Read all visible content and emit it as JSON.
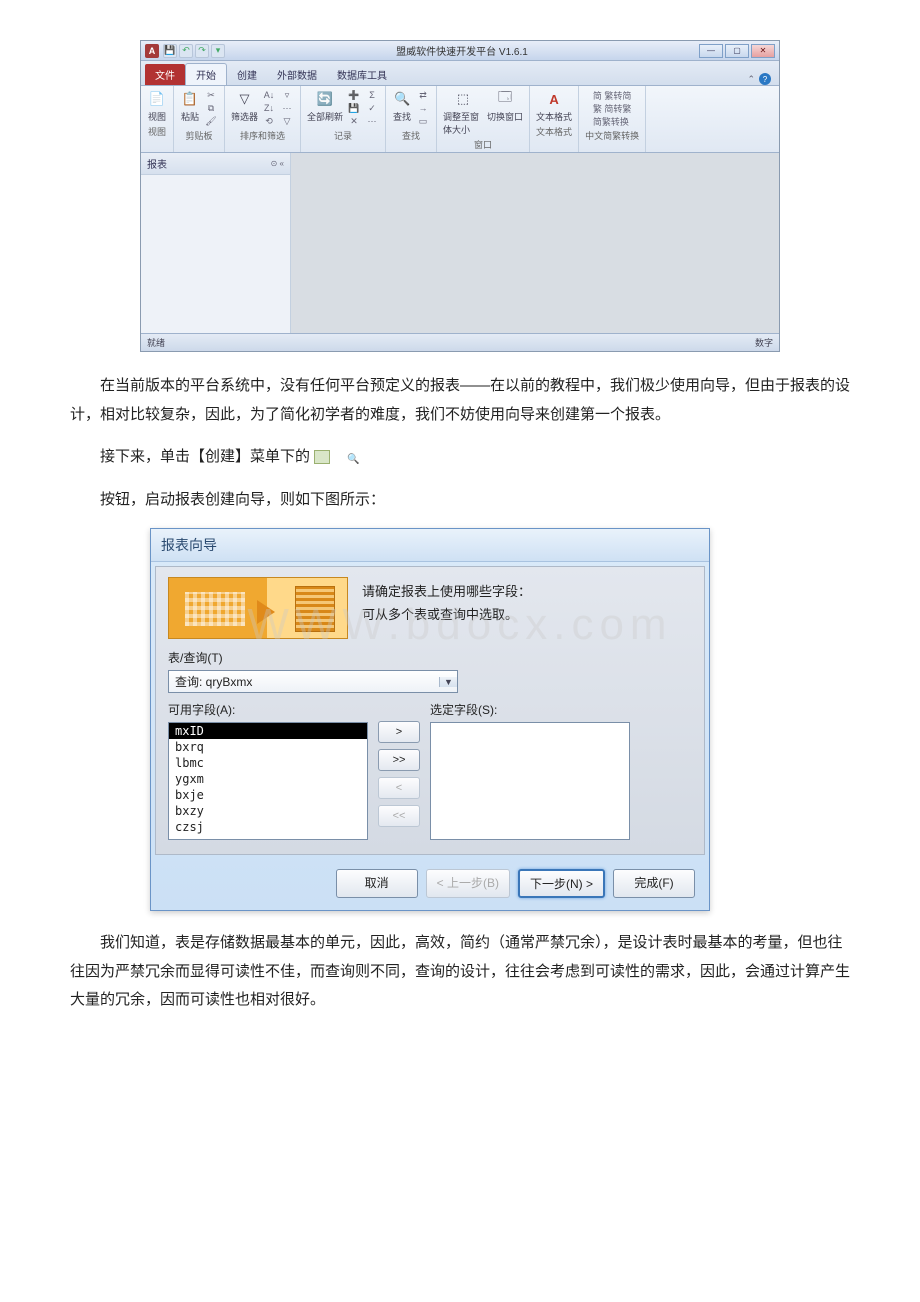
{
  "access": {
    "title": "盟威软件快速开发平台 V1.6.1",
    "file_tab": "文件",
    "tabs": [
      "开始",
      "创建",
      "外部数据",
      "数据库工具"
    ],
    "win": {
      "min": "—",
      "max": "▢",
      "close": "✕",
      "collapse": "⌃",
      "help": "?"
    },
    "groups": {
      "view": {
        "label": "视图",
        "btn": "视图"
      },
      "clipboard": {
        "label": "剪贴板",
        "btn": "粘贴"
      },
      "sort": {
        "label": "排序和筛选",
        "btn": "筛选器"
      },
      "records": {
        "label": "记录",
        "btn": "全部刷新"
      },
      "find": {
        "label": "查找",
        "btn": "查找"
      },
      "window": {
        "label": "窗口",
        "resize": "调整至窗体大小",
        "switch": "切换窗口"
      },
      "textfmt": {
        "label": "文本格式",
        "btn": "文本格式"
      },
      "zhconv": {
        "label": "中文简繁转换",
        "a": "简 繁转简",
        "b": "繁 简转繁",
        "c": "简繁转换"
      }
    },
    "nav": {
      "header": "报表",
      "toggle": "⊙ «"
    },
    "status": {
      "left": "就绪",
      "right": "数字"
    }
  },
  "para1": "在当前版本的平台系统中，没有任何平台预定义的报表——在以前的教程中，我们极少使用向导，但由于报表的设计，相对比较复杂，因此，为了简化初学者的难度，我们不妨使用向导来创建第一个报表。",
  "para2a": "接下来，单击【创建】菜单下的 ",
  "para3": "按钮，启动报表创建向导，则如下图所示：",
  "wizard": {
    "title": "报表向导",
    "head1": "请确定报表上使用哪些字段：",
    "head2": "可从多个表或查询中选取。",
    "tq_label": "表/查询(T)",
    "combo_value": "查询: qryBxmx",
    "avail_label": "可用字段(A):",
    "sel_label": "选定字段(S):",
    "fields": [
      "mxID",
      "bxrq",
      "lbmc",
      "ygxm",
      "bxje",
      "bxzy",
      "czsj"
    ],
    "btns": {
      "add": ">",
      "add_all": ">>",
      "rem": "<",
      "rem_all": "<<"
    },
    "footer": {
      "cancel": "取消",
      "back": "< 上一步(B)",
      "next": "下一步(N) >",
      "finish": "完成(F)"
    }
  },
  "para4": "我们知道，表是存储数据最基本的单元，因此，高效，简约（通常严禁冗余），是设计表时最基本的考量，但也往往因为严禁冗余而显得可读性不佳，而查询则不同，查询的设计，往往会考虑到可读性的需求，因此，会通过计算产生大量的冗余，因而可读性也相对很好。",
  "watermark": "WWW.bdocx.com"
}
